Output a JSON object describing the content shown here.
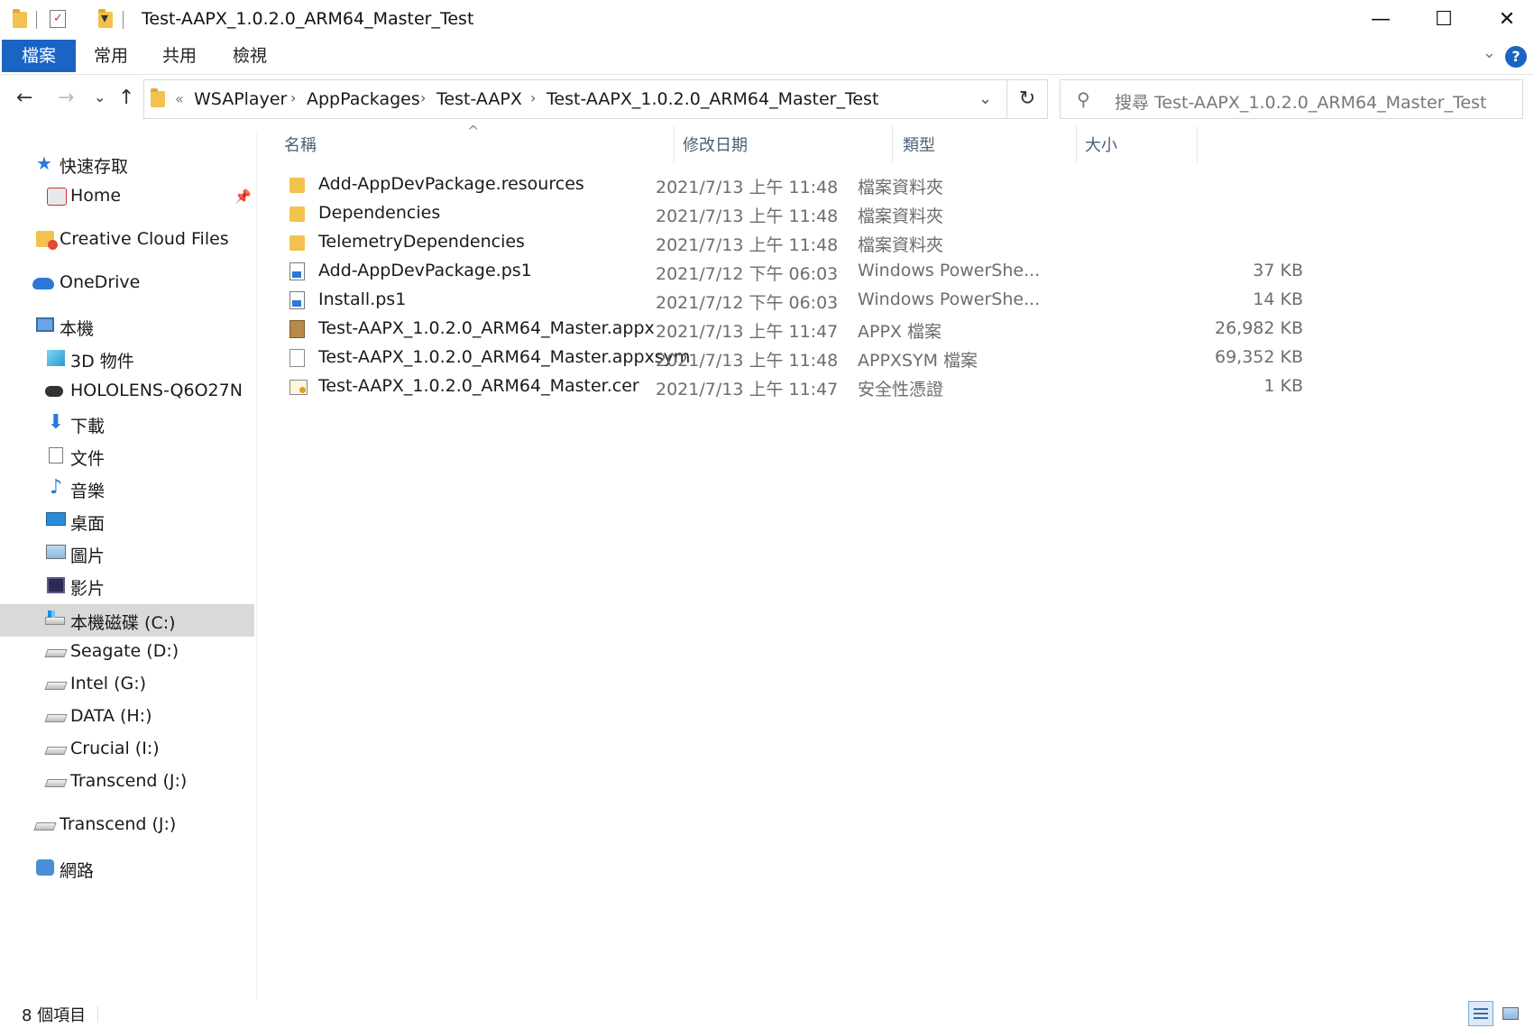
{
  "window": {
    "title": "Test-AAPX_1.0.2.0_ARM64_Master_Test",
    "minimize_glyph": "—",
    "maximize_glyph": "☐",
    "close_glyph": "✕",
    "dropdown_glyph": "▾"
  },
  "ribbon": {
    "tabs": [
      {
        "label": "檔案",
        "active": true
      },
      {
        "label": "常用",
        "active": false
      },
      {
        "label": "共用",
        "active": false
      },
      {
        "label": "檢視",
        "active": false
      }
    ],
    "collapse_glyph": "⌄",
    "help_glyph": "?"
  },
  "nav": {
    "back_glyph": "←",
    "forward_glyph": "→",
    "recent_glyph": "⌄",
    "up_glyph": "↑",
    "refresh_glyph": "↻",
    "overflow_glyph": "«",
    "separator_glyph": "›",
    "address_dropdown_glyph": "⌄",
    "breadcrumb": [
      "WSAPlayer",
      "AppPackages",
      "Test-AAPX",
      "Test-AAPX_1.0.2.0_ARM64_Master_Test"
    ],
    "search_placeholder": "搜尋 Test-AAPX_1.0.2.0_ARM64_Master_Test",
    "search_icon_glyph": "⚲"
  },
  "sidebar": {
    "items": [
      {
        "label": "快速存取",
        "icon": "star-icon"
      },
      {
        "label": "Home",
        "icon": "home-icon",
        "pinned": true
      },
      {
        "label": "Creative Cloud Files",
        "icon": "creative-cloud-icon"
      },
      {
        "label": "OneDrive",
        "icon": "onedrive-icon"
      },
      {
        "label": "本機",
        "icon": "this-pc-icon"
      },
      {
        "label": "3D 物件",
        "icon": "3d-objects-icon"
      },
      {
        "label": "HOLOLENS-Q6O27N",
        "icon": "hololens-icon"
      },
      {
        "label": "下載",
        "icon": "downloads-icon"
      },
      {
        "label": "文件",
        "icon": "documents-icon"
      },
      {
        "label": "音樂",
        "icon": "music-icon"
      },
      {
        "label": "桌面",
        "icon": "desktop-icon"
      },
      {
        "label": "圖片",
        "icon": "pictures-icon"
      },
      {
        "label": "影片",
        "icon": "videos-icon"
      },
      {
        "label": "本機磁碟 (C:)",
        "icon": "local-disk-icon",
        "selected": true
      },
      {
        "label": "Seagate (D:)",
        "icon": "drive-icon"
      },
      {
        "label": "Intel (G:)",
        "icon": "drive-icon"
      },
      {
        "label": "DATA (H:)",
        "icon": "drive-icon"
      },
      {
        "label": "Crucial (I:)",
        "icon": "drive-icon"
      },
      {
        "label": "Transcend (J:)",
        "icon": "drive-icon"
      },
      {
        "label": "Transcend (J:)",
        "icon": "drive-icon"
      },
      {
        "label": "網路",
        "icon": "network-icon"
      }
    ],
    "pin_glyph": "📌"
  },
  "list": {
    "sort_glyph": "^",
    "columns": {
      "name": "名稱",
      "date": "修改日期",
      "type": "類型",
      "size": "大小"
    },
    "files": [
      {
        "name": "Add-AppDevPackage.resources",
        "date": "2021/7/13 上午 11:48",
        "type": "檔案資料夾",
        "size": "",
        "icon": "folder-icon"
      },
      {
        "name": "Dependencies",
        "date": "2021/7/13 上午 11:48",
        "type": "檔案資料夾",
        "size": "",
        "icon": "folder-icon"
      },
      {
        "name": "TelemetryDependencies",
        "date": "2021/7/13 上午 11:48",
        "type": "檔案資料夾",
        "size": "",
        "icon": "folder-icon"
      },
      {
        "name": "Add-AppDevPackage.ps1",
        "date": "2021/7/12 下午 06:03",
        "type": "Windows PowerShe...",
        "size": "37 KB",
        "icon": "powershell-script-icon"
      },
      {
        "name": "Install.ps1",
        "date": "2021/7/12 下午 06:03",
        "type": "Windows PowerShe...",
        "size": "14 KB",
        "icon": "powershell-script-icon"
      },
      {
        "name": "Test-AAPX_1.0.2.0_ARM64_Master.appx",
        "date": "2021/7/13 上午 11:47",
        "type": "APPX 檔案",
        "size": "26,982 KB",
        "icon": "appx-package-icon"
      },
      {
        "name": "Test-AAPX_1.0.2.0_ARM64_Master.appxsym",
        "date": "2021/7/13 上午 11:48",
        "type": "APPXSYM 檔案",
        "size": "69,352 KB",
        "icon": "blank-file-icon"
      },
      {
        "name": "Test-AAPX_1.0.2.0_ARM64_Master.cer",
        "date": "2021/7/13 上午 11:47",
        "type": "安全性憑證",
        "size": "1 KB",
        "icon": "certificate-icon"
      }
    ]
  },
  "status": {
    "item_count": "8 個項目"
  }
}
